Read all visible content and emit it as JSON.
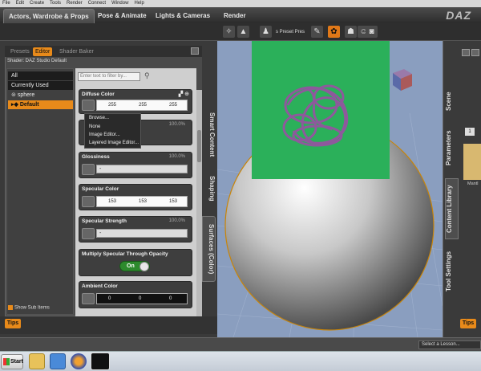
{
  "menu": [
    "File",
    "Edit",
    "Create",
    "Tools",
    "Render",
    "Connect",
    "Window",
    "Help"
  ],
  "rooms": [
    "Actors, Wardrobe & Props",
    "Pose & Animate",
    "Lights & Cameras",
    "Render"
  ],
  "brand": "DAZ",
  "toolbar": {
    "label": "s Preset  Pres"
  },
  "left_tabs": [
    "Presets",
    "Editor",
    "Shader Baker"
  ],
  "shader_line": "Shader: DAZ Studio Default",
  "tree": {
    "all": "All",
    "currently_used": "Currently Used",
    "node": "sphere",
    "surface": "Default"
  },
  "filter_placeholder": "Enter text to filter by...",
  "props": {
    "diffuse": {
      "title": "Diffuse Color",
      "r": "255",
      "g": "255",
      "b": "255"
    },
    "diffuse_strength": {
      "pct": "100.0%"
    },
    "glossiness": {
      "title": "Glossiness",
      "pct": "100.0%",
      "slider": "-"
    },
    "specular": {
      "title": "Specular Color",
      "r": "153",
      "g": "153",
      "b": "153"
    },
    "specular_strength": {
      "title": "Specular Strength",
      "pct": "100.0%",
      "slider": "-"
    },
    "multiply": {
      "title": "Multiply Specular Through Opacity",
      "toggle": "On"
    },
    "ambient": {
      "title": "Ambient Color",
      "r": "0",
      "g": "0",
      "b": "0"
    }
  },
  "context_menu": [
    "Browse...",
    "None",
    "Image Editor...",
    "Layered Image Editor..."
  ],
  "left_vtabs": [
    "Smart Content",
    "Shaping",
    "Surfaces (Color)"
  ],
  "right_vtabs": [
    "Scene",
    "Parameters",
    "Content Library",
    "Tool Settings"
  ],
  "show_sub_items": "Show Sub Items",
  "tips": "Tips",
  "right_tips": "Tips",
  "mantle_label": "Mantl",
  "right_number": "1",
  "lesson": "Select a Lesson...",
  "start": "Start",
  "colors": {
    "accent": "#e88a1a",
    "render_bg": "#2bb05a",
    "viewport": "#8a9ebf",
    "stroke": "#a04aa8"
  },
  "icons": [
    "start-orb-icon",
    "folder-icon",
    "media-player-icon",
    "firefox-icon",
    "daz-studio-icon"
  ]
}
